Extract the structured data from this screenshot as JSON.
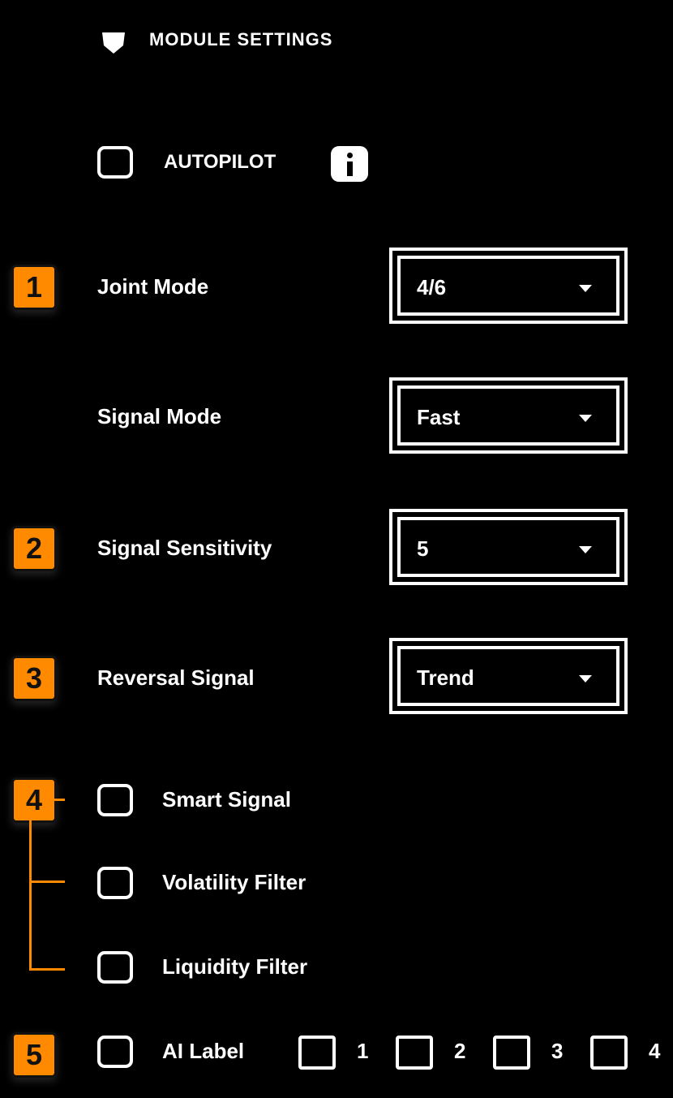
{
  "header": {
    "title": "MODULE SETTINGS",
    "icon": "logo-icon"
  },
  "autopilot": {
    "label": "AUTOPILOT",
    "checked": false,
    "info_icon": "info-icon"
  },
  "fields": [
    {
      "badge": "1",
      "label": "Joint Mode",
      "value": "4/6"
    },
    {
      "badge": "",
      "label": "Signal Mode",
      "value": "Fast"
    },
    {
      "badge": "2",
      "label": "Signal Sensitivity",
      "value": "5"
    },
    {
      "badge": "3",
      "label": "Reversal Signal",
      "value": "Trend"
    }
  ],
  "filters": {
    "badge": "4",
    "items": [
      {
        "label": "Smart Signal",
        "checked": false
      },
      {
        "label": "Volatility Filter",
        "checked": false
      },
      {
        "label": "Liquidity Filter",
        "checked": false
      }
    ]
  },
  "ai_row": {
    "badge": "5",
    "label": "AI Label",
    "options": [
      {
        "label": "1",
        "checked": false
      },
      {
        "label": "2",
        "checked": false
      },
      {
        "label": "3",
        "checked": false
      },
      {
        "label": "4",
        "checked": false
      }
    ]
  },
  "colors": {
    "accent": "#ff8a00",
    "background": "#000000",
    "foreground": "#ffffff"
  }
}
